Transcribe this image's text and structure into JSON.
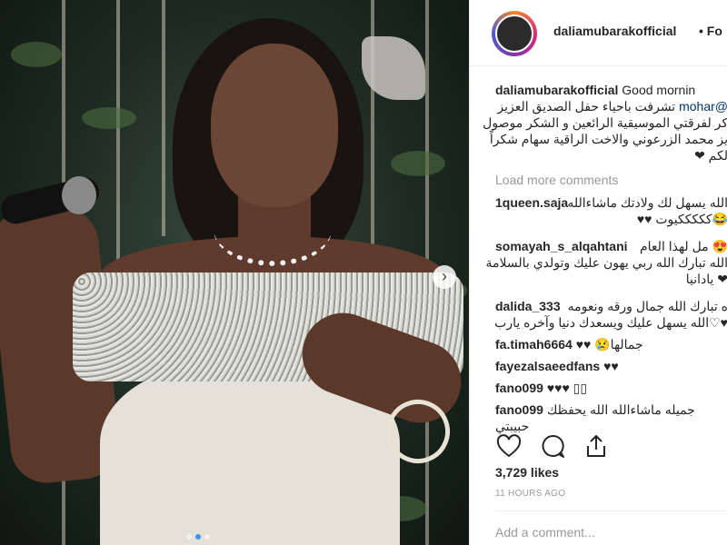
{
  "header": {
    "username": "daliamubarakofficial",
    "follow": "• Fo"
  },
  "caption": {
    "username": "daliamubarakofficial",
    "line1_rest": "Good mornin",
    "line2": "تشرفت باحياء حفل الصديق العزيز",
    "mention": "@mohar",
    "line3": "كر لفرقتي الموسيقية الرائعين و الشكر موصول",
    "line4": "يز محمد الزرعوني والاخت الراقية سهام شكراً",
    "line5": "لكم ❤"
  },
  "load_more": "Load more comments",
  "comments": [
    {
      "user": "1queen.saja",
      "text": "الله يسهل لك ولادتك ماشاءالله",
      "text2": "😂كككككيوت ♥♥"
    },
    {
      "user": "somayah_s_alqahtani",
      "text": "😍 مل لهذا العام",
      "text2": "الله تبارك الله ربي يهون عليك وتولدي بالسلامة",
      "text3": "❤ يادانيا"
    },
    {
      "user": "dalida_333",
      "text": "ه تبارك الله جمال ورقه ونعومه",
      "text2": "♥♡الله يسهل عليك ويسعدك دنيا وآخره يارب"
    },
    {
      "user": "fa.timah6664",
      "text": "♥♥ 😢جمالها"
    },
    {
      "user": "fayezalsaeedfans",
      "text": "♥♥"
    },
    {
      "user": "fano099",
      "text": "♥♥♥ ▯▯"
    },
    {
      "user": "fano099",
      "text": "جميله ماشاءالله الله يحفظك حبيبتي"
    }
  ],
  "likes": "3,729 likes",
  "time_ago": "11 HOURS AGO",
  "add_comment": "Add a comment...",
  "icons": {
    "heart": "heart-icon",
    "comment": "comment-icon",
    "share": "share-icon",
    "next": "chevron-right-icon"
  },
  "carousel": {
    "count": 3,
    "active": 2
  }
}
